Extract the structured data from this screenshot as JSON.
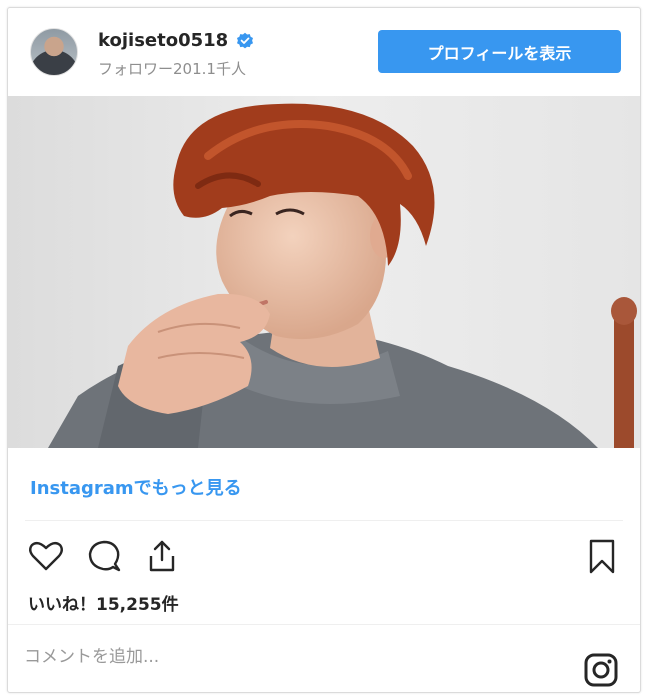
{
  "header": {
    "username": "kojiseto0518",
    "followers": "フォロワー201.1千人",
    "profile_button": "プロフィールを表示"
  },
  "post": {
    "more_link": "Instagramでもっと見る",
    "likes": "いいね！15,255件"
  },
  "actions": {
    "icons": [
      "heart-icon",
      "comment-icon",
      "share-icon",
      "bookmark-icon"
    ]
  },
  "comment": {
    "placeholder": "コメントを追加..."
  },
  "colors": {
    "accent": "#3897f0",
    "text": "#262626",
    "muted": "#8e8e8e",
    "border": "#dbdbdb"
  }
}
